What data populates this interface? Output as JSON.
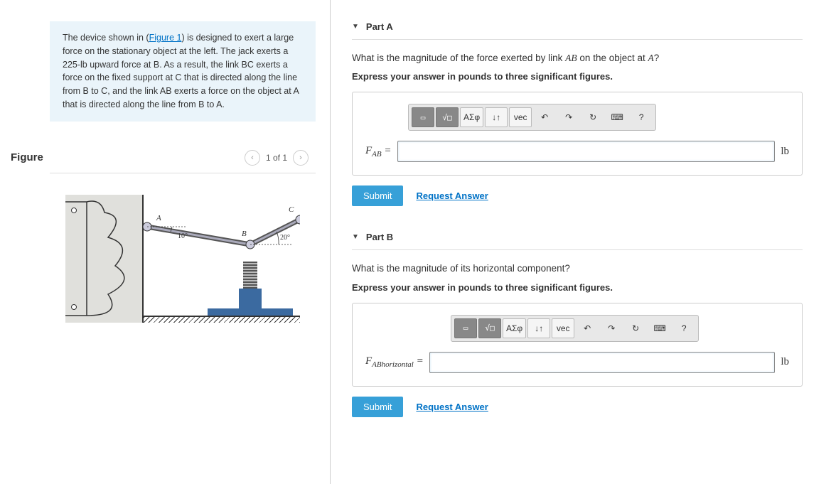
{
  "problem": {
    "pre": "The device shown in (",
    "fig_link": "Figure 1",
    "post": ") is designed to exert a large force on the stationary object at the left. The jack exerts a 225-lb upward force at B. As a result, the link BC exerts a force on the fixed support at C that is directed along the line from B to C, and the link AB exerts a force on the object at A that is directed along the line from B to A."
  },
  "figure": {
    "title": "Figure",
    "counter": "1 of 1",
    "labels": {
      "A": "A",
      "B": "B",
      "C": "C",
      "ang1": "10°",
      "ang2": "20°"
    }
  },
  "partA": {
    "title": "Part A",
    "question_pre": "What is the magnitude of the force exerted by link ",
    "question_mid": " on the object at ",
    "question_end": "?",
    "link": "AB",
    "point": "A",
    "instruct": "Express your answer in pounds to three significant figures.",
    "var_html": "F<sub>AB</sub> =",
    "unit": "lb",
    "submit": "Submit",
    "request": "Request Answer"
  },
  "partB": {
    "title": "Part B",
    "question": "What is the magnitude of its horizontal component?",
    "instruct": "Express your answer in pounds to three significant figures.",
    "var_html": "F<sub>ABhorizontal</sub> =",
    "unit": "lb",
    "submit": "Submit",
    "request": "Request Answer"
  },
  "toolbar": {
    "templates": "▭",
    "sqrt": "√□",
    "greek": "ΑΣφ",
    "subsup": "↓↑",
    "vec": "vec",
    "undo": "↶",
    "redo": "↷",
    "reset": "↻",
    "keyboard": "⌨",
    "help": "?"
  }
}
